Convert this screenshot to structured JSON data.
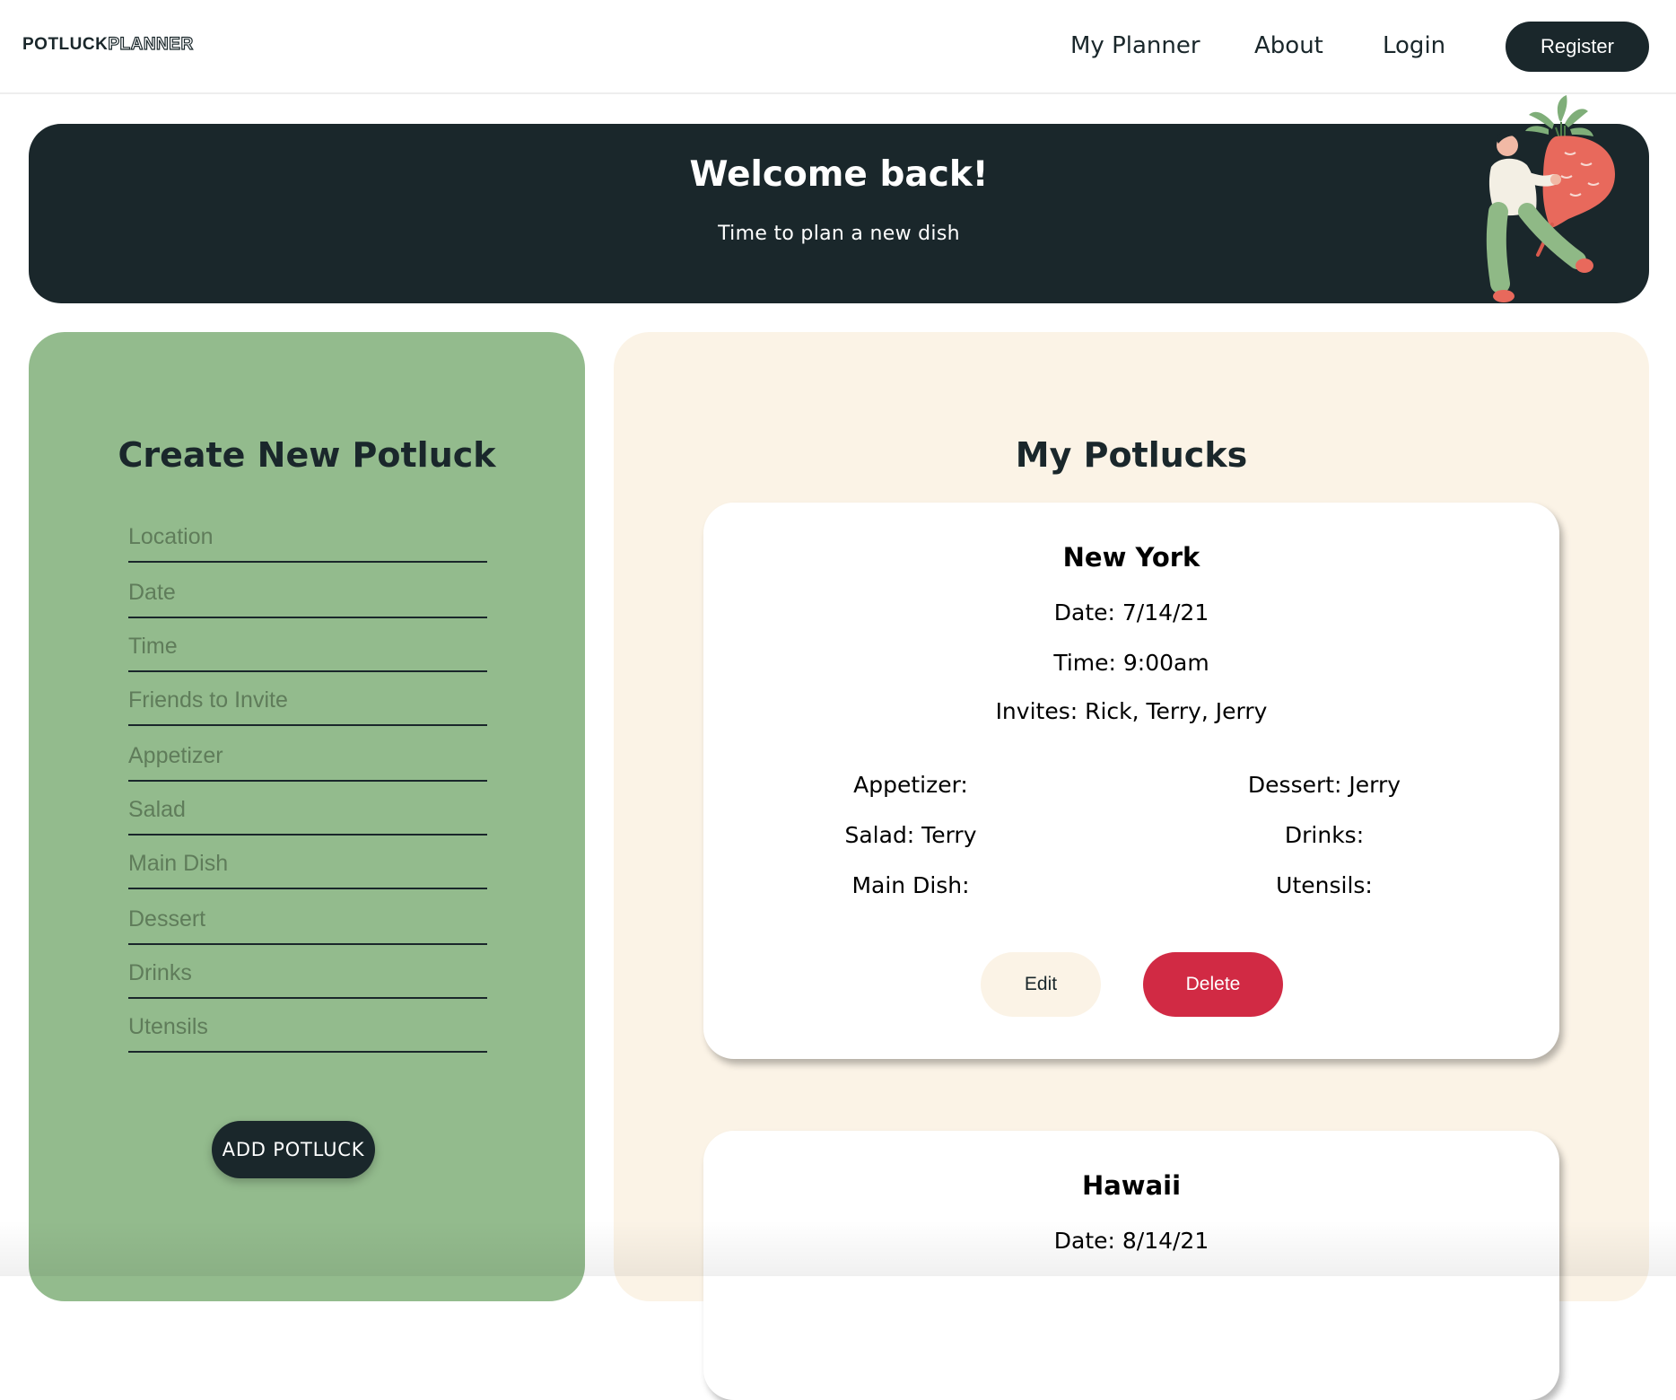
{
  "nav": {
    "logo_bold": "POTLUCK",
    "logo_outline": "PLANNER",
    "links": [
      "My Planner",
      "About",
      "Login"
    ],
    "register_label": "Register"
  },
  "hero": {
    "title": "Welcome back!",
    "subtitle": "Time to plan a new dish"
  },
  "create": {
    "title": "Create New Potluck",
    "fields": [
      {
        "placeholder": "Location",
        "value": ""
      },
      {
        "placeholder": "Date",
        "value": ""
      },
      {
        "placeholder": "Time",
        "value": ""
      },
      {
        "placeholder": "Friends to Invite",
        "value": ""
      },
      {
        "placeholder": "Appetizer",
        "value": ""
      },
      {
        "placeholder": "Salad",
        "value": ""
      },
      {
        "placeholder": "Main Dish",
        "value": ""
      },
      {
        "placeholder": "Dessert",
        "value": ""
      },
      {
        "placeholder": "Drinks",
        "value": ""
      },
      {
        "placeholder": "Utensils",
        "value": ""
      }
    ],
    "add_label": "ADD POTLUCK"
  },
  "potlucks": {
    "title": "My Potlucks",
    "items": [
      {
        "name": "New York",
        "date": "Date: 7/14/21",
        "time": "Time: 9:00am",
        "invites": "Invites: Rick, Terry, Jerry",
        "appetizer": "Appetizer:",
        "salad": "Salad: Terry",
        "main_dish": "Main Dish:",
        "dessert": "Dessert: Jerry",
        "drinks": "Drinks:",
        "utensils": "Utensils:",
        "edit_label": "Edit",
        "delete_label": "Delete"
      },
      {
        "name": "Hawaii",
        "date": "Date: 8/14/21"
      }
    ]
  },
  "colors": {
    "dark": "#1a272b",
    "green": "#93bb8d",
    "cream": "#fbf3e6",
    "delete_red": "#d12a44"
  },
  "icons": {
    "hero_illustration": "person-carrying-radish-illustration"
  }
}
